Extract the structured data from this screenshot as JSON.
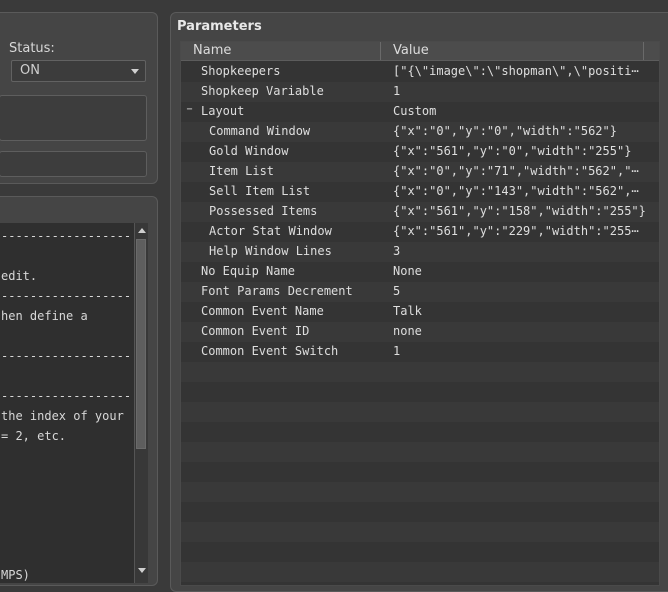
{
  "status": {
    "label": "Status:",
    "value": "ON"
  },
  "help": {
    "lines": [
      "------------------",
      "edit.",
      "------------------",
      "hen define a",
      "------------------",
      "------------------",
      "the index of your",
      "= 2, etc.",
      "MPS)"
    ]
  },
  "parameters": {
    "title": "Parameters",
    "columns": {
      "name": "Name",
      "value": "Value"
    },
    "rows": [
      {
        "name": "Shopkeepers",
        "value": "[\"{\\\"image\\\":\\\"shopman\\\",\\\"positi⋯"
      },
      {
        "name": "Shopkeep Variable",
        "value": "1"
      },
      {
        "name": "Layout",
        "value": "Custom",
        "collapse": "−"
      },
      {
        "name": "Command Window",
        "value": "{\"x\":\"0\",\"y\":\"0\",\"width\":\"562\"}"
      },
      {
        "name": "Gold Window",
        "value": "{\"x\":\"561\",\"y\":\"0\",\"width\":\"255\"}"
      },
      {
        "name": "Item List",
        "value": "{\"x\":\"0\",\"y\":\"71\",\"width\":\"562\",\"⋯"
      },
      {
        "name": "Sell Item List",
        "value": "{\"x\":\"0\",\"y\":\"143\",\"width\":\"562\",⋯"
      },
      {
        "name": "Possessed Items",
        "value": "{\"x\":\"561\",\"y\":\"158\",\"width\":\"255\"}"
      },
      {
        "name": "Actor Stat Window",
        "value": "{\"x\":\"561\",\"y\":\"229\",\"width\":\"255⋯"
      },
      {
        "name": "Help Window Lines",
        "value": "3"
      },
      {
        "name": "No Equip Name",
        "value": "None"
      },
      {
        "name": "Font Params Decrement",
        "value": "5"
      },
      {
        "name": "Common Event Name",
        "value": "Talk"
      },
      {
        "name": "Common Event ID",
        "value": "none"
      },
      {
        "name": "Common Event Switch",
        "value": "1"
      }
    ]
  },
  "icons": {
    "dropdown": "chevron-down-icon",
    "collapse": "collapse-minus-icon",
    "scroll_up": "scroll-up-arrow-icon",
    "scroll_down": "scroll-down-arrow-icon"
  }
}
